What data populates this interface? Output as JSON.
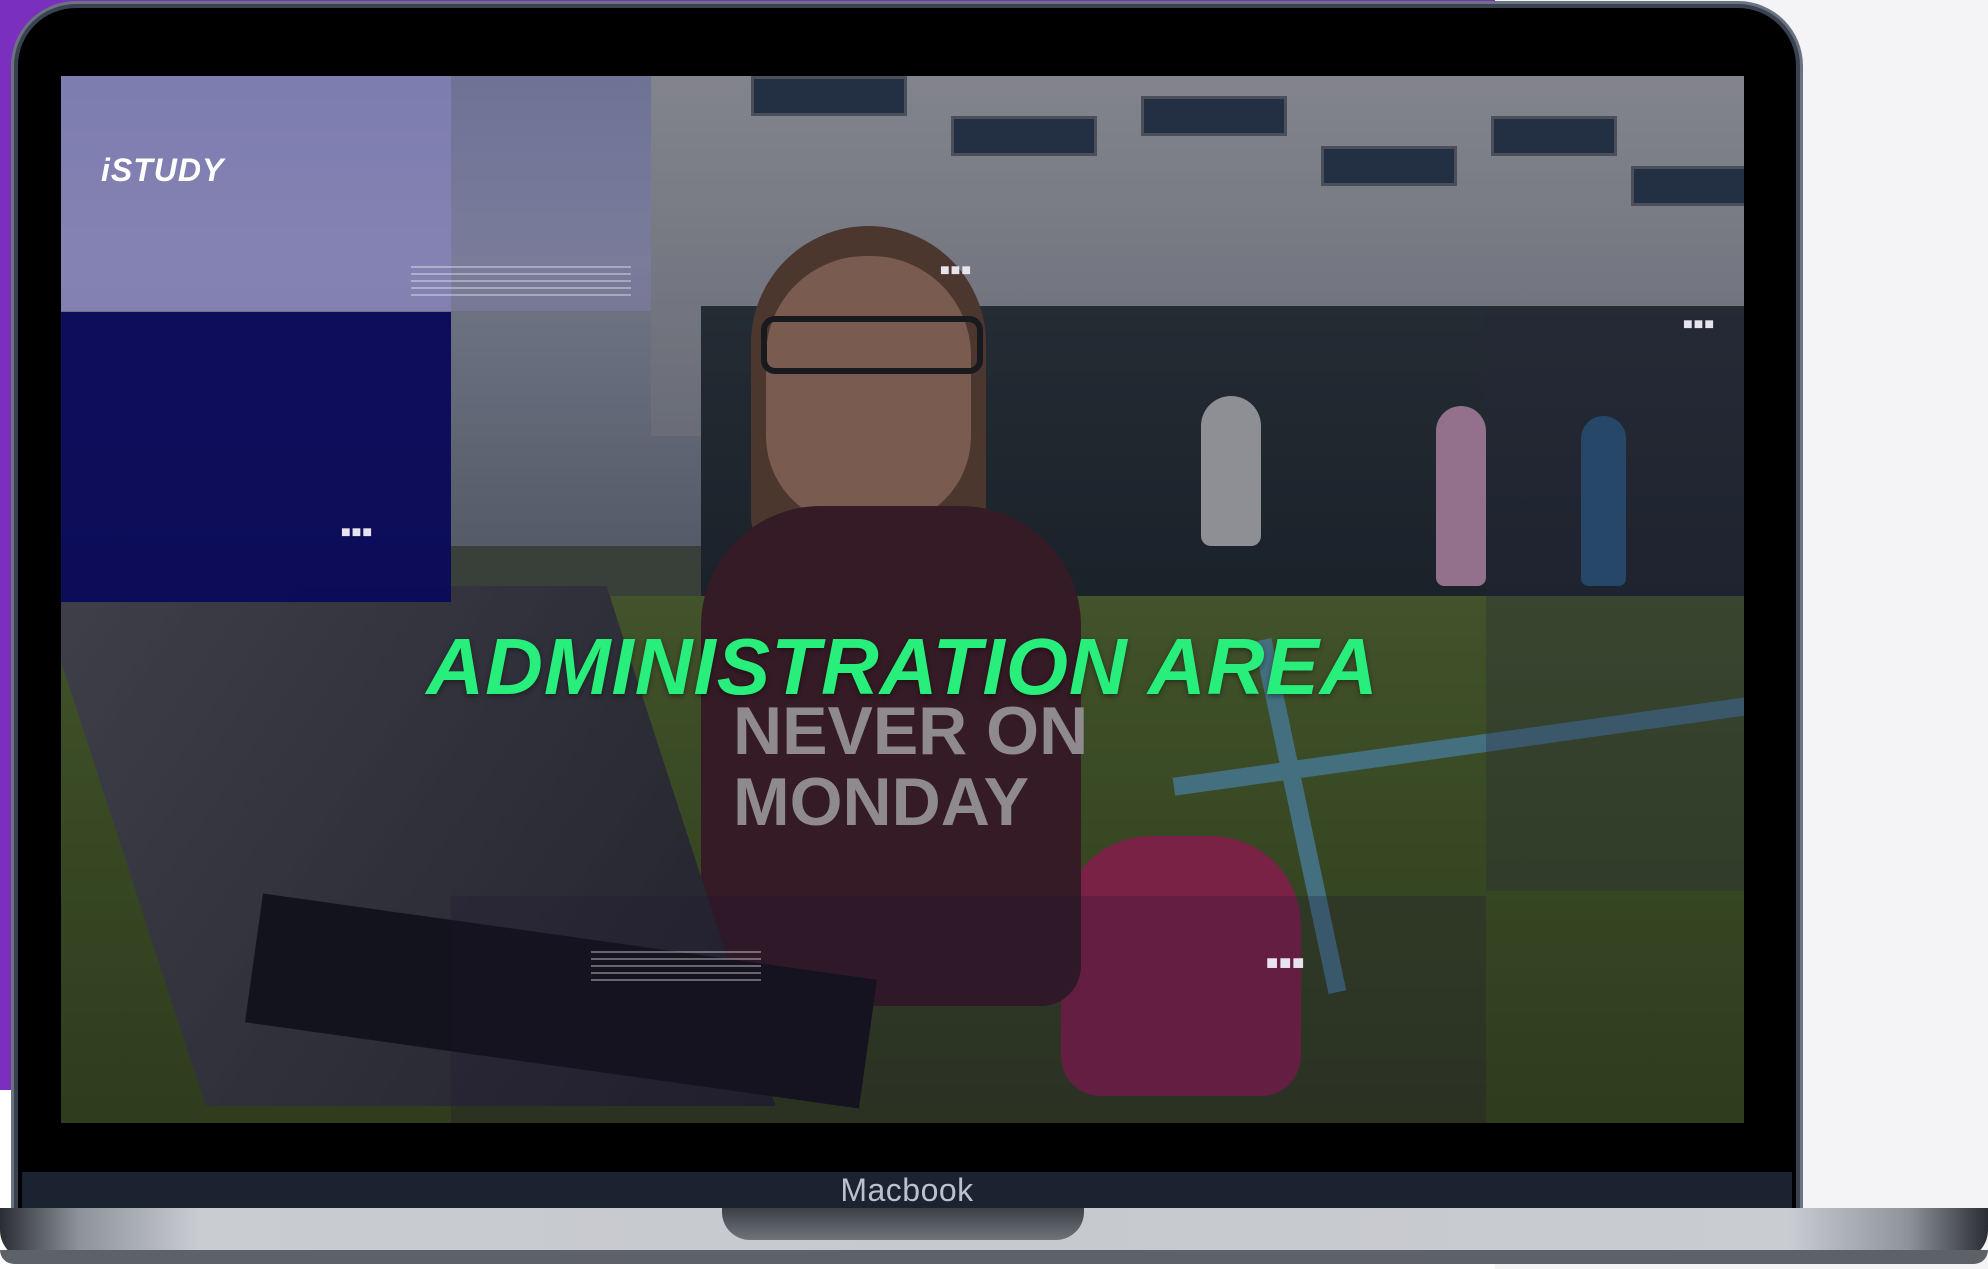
{
  "device": {
    "label": "Macbook"
  },
  "slide": {
    "logo": "iSTUDY",
    "headline": "ADMINISTRATION AREA",
    "shirt_text": "NEVER ON\nMONDAY",
    "dots": "■■■"
  },
  "colors": {
    "background_accent": "#7a2fbe",
    "headline_color": "#28ef7b",
    "navy_panel": "#0a0a5a"
  }
}
